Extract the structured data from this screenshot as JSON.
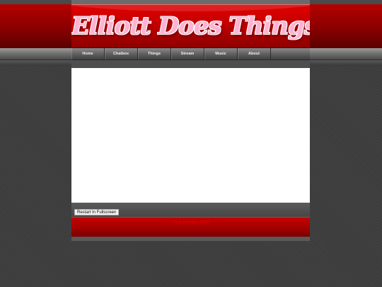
{
  "header": {
    "title": "Elliott Does Things"
  },
  "nav": {
    "items": [
      {
        "label": "Home"
      },
      {
        "label": "Chatbox"
      },
      {
        "label": "Things"
      },
      {
        "label": "Stream"
      },
      {
        "label": "Music"
      },
      {
        "label": "About"
      }
    ]
  },
  "controls": {
    "restart_label": "Restart In Fullscreen"
  },
  "footer": {
    "text": "Top to the Page",
    "separator": " · ",
    "link": "Elliott"
  }
}
